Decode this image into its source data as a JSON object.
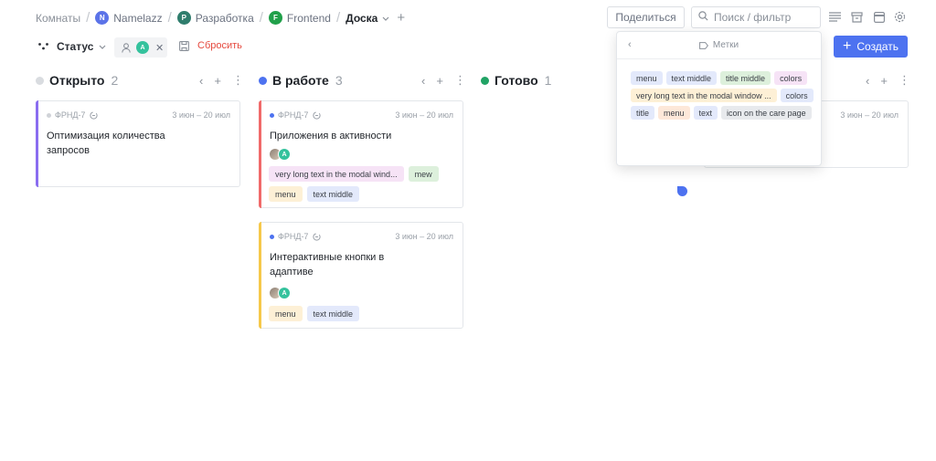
{
  "breadcrumbs": [
    {
      "label": "Комнаты",
      "avatar": null,
      "color": null
    },
    {
      "label": "Namelazz",
      "avatar": "N",
      "color": "#5b73e8"
    },
    {
      "label": "Разработка",
      "avatar": "P",
      "color": "#2f7d6d"
    },
    {
      "label": "Frontend",
      "avatar": "F",
      "color": "#21a04a"
    },
    {
      "label": "Доска",
      "avatar": null,
      "color": null
    }
  ],
  "toolbar": {
    "share_label": "Поделиться",
    "search_placeholder": "Поиск / фильтр",
    "icons": [
      "list-icon",
      "archive-icon",
      "window-icon",
      "gear-icon"
    ]
  },
  "filterbar": {
    "status_label": "Статус",
    "user_avatar": "A",
    "reset_label": "Сбросить",
    "create_label": "Создать"
  },
  "columns": [
    {
      "title": "Открыто",
      "count": "2",
      "color": "#d9dce0"
    },
    {
      "title": "В работе",
      "count": "3",
      "color": "#4d72f0"
    },
    {
      "title": "Готово",
      "count": "1",
      "color": "#21a365"
    }
  ],
  "cards": [
    {
      "id": "ФРНД-7",
      "dates": "3 июн – 20 июл",
      "title_lines": [
        "Оптимизация количества",
        "запросов"
      ],
      "bar_color": "#8a6df0",
      "dot_color": "#d0d3d8",
      "avatars": [],
      "tags": []
    },
    {
      "id": "ФРНД-7",
      "dates": "3 июн – 20 июл",
      "title_lines": [
        "Приложения в активности"
      ],
      "bar_color": "#f06a6a",
      "dot_color": "#4d72f0",
      "avatars": [
        "photo",
        "A"
      ],
      "tags": [
        {
          "label": "very long text in the modal wind...",
          "bg": "#f6e3f6"
        },
        {
          "label": "mew",
          "bg": "#ddf0dc"
        },
        {
          "label": "menu",
          "bg": "#fdf0d6"
        },
        {
          "label": "text middle",
          "bg": "#e3e9fb"
        }
      ]
    },
    {
      "id": "ФРНД-7",
      "dates": "3 июн – 20 июл",
      "title_lines": [
        "Интерактивные кнопки в",
        "адаптиве"
      ],
      "bar_color": "#f6c84a",
      "dot_color": "#4d72f0",
      "avatars": [
        "photo",
        "A"
      ],
      "tags": [
        {
          "label": "menu",
          "bg": "#fdf0d6"
        },
        {
          "label": "text middle",
          "bg": "#e3e9fb"
        }
      ]
    },
    {
      "id": "",
      "dates": "3 июн – 20 июл",
      "title_lines": [],
      "bar_color": "#ffffff",
      "dot_color": "#ffffff",
      "avatars": [],
      "tags": []
    }
  ],
  "popover": {
    "title": "Метки",
    "tags": [
      {
        "label": "menu",
        "bg": "#e3e9fb"
      },
      {
        "label": "text middle",
        "bg": "#e3e9fb"
      },
      {
        "label": "title middle",
        "bg": "#ddf0dc"
      },
      {
        "label": "colors",
        "bg": "#f6e3f6"
      },
      {
        "label": "very long text in the modal window ...",
        "bg": "#fdf0d6"
      },
      {
        "label": "colors",
        "bg": "#e3e9fb"
      },
      {
        "label": "title",
        "bg": "#e3e9fb"
      },
      {
        "label": "menu",
        "bg": "#fde8d9"
      },
      {
        "label": "text",
        "bg": "#e3e9fb"
      },
      {
        "label": "icon on the care page",
        "bg": "#e8eaed"
      }
    ]
  }
}
